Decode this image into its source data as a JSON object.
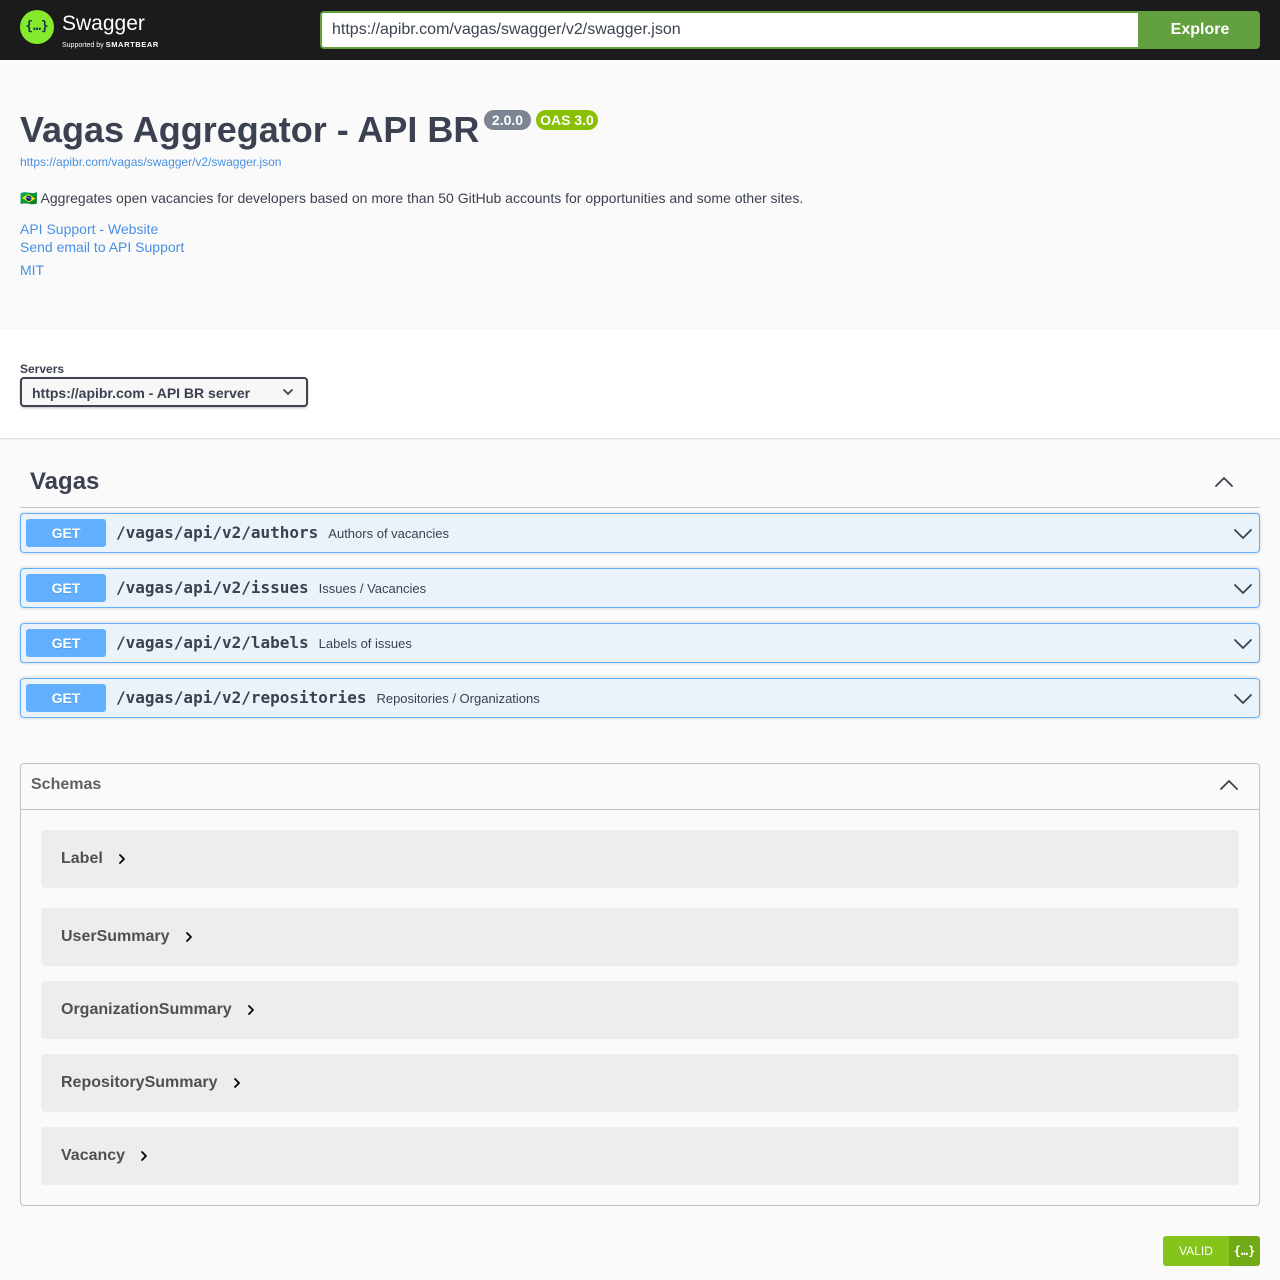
{
  "topbar": {
    "logo_text": "Swagger",
    "logo_sub_prefix": "Supported by",
    "logo_sub_brand": "SMARTBEAR",
    "logo_symbol": "{…}",
    "url_value": "https://apibr.com/vagas/swagger/v2/swagger.json",
    "explore_label": "Explore"
  },
  "info": {
    "title": "Vagas Aggregator - API BR",
    "version": "2.0.0",
    "oas_badge": "OAS 3.0",
    "spec_url": "https://apibr.com/vagas/swagger/v2/swagger.json",
    "description": "🇧🇷 Aggregates open vacancies for developers based on more than 50 GitHub accounts for opportunities and some other sites.",
    "support_website": "API Support - Website",
    "support_email": "Send email to API Support",
    "license": "MIT"
  },
  "servers": {
    "label": "Servers",
    "selected": "https://apibr.com - API BR server"
  },
  "tag": {
    "name": "Vagas"
  },
  "operations": [
    {
      "method": "GET",
      "path": "/vagas/api/v2/authors",
      "summary": "Authors of vacancies"
    },
    {
      "method": "GET",
      "path": "/vagas/api/v2/issues",
      "summary": "Issues / Vacancies"
    },
    {
      "method": "GET",
      "path": "/vagas/api/v2/labels",
      "summary": "Labels of issues"
    },
    {
      "method": "GET",
      "path": "/vagas/api/v2/repositories",
      "summary": "Repositories / Organizations"
    }
  ],
  "schemas": {
    "title": "Schemas",
    "items": [
      "Label",
      "UserSummary",
      "OrganizationSummary",
      "RepositorySummary",
      "Vacancy"
    ]
  },
  "validator": {
    "label": "VALID",
    "symbol": "{…}"
  },
  "colors": {
    "topbar_bg": "#1b1b1b",
    "explore_green": "#62a03f",
    "get_blue": "#61affe",
    "oas_green": "#89bf04",
    "version_gray": "#7d8492",
    "link_blue": "#4990e2",
    "valid_green": "#85c51b"
  },
  "icons": {
    "logo": "swagger-logo-icon",
    "server_dropdown": "chevron-down-icon",
    "tag_toggle": "chevron-up-icon",
    "operation_toggle": "chevron-down-icon",
    "schemas_toggle": "chevron-up-icon",
    "model_expand": "chevron-right-icon",
    "validator": "curly-braces-icon"
  }
}
